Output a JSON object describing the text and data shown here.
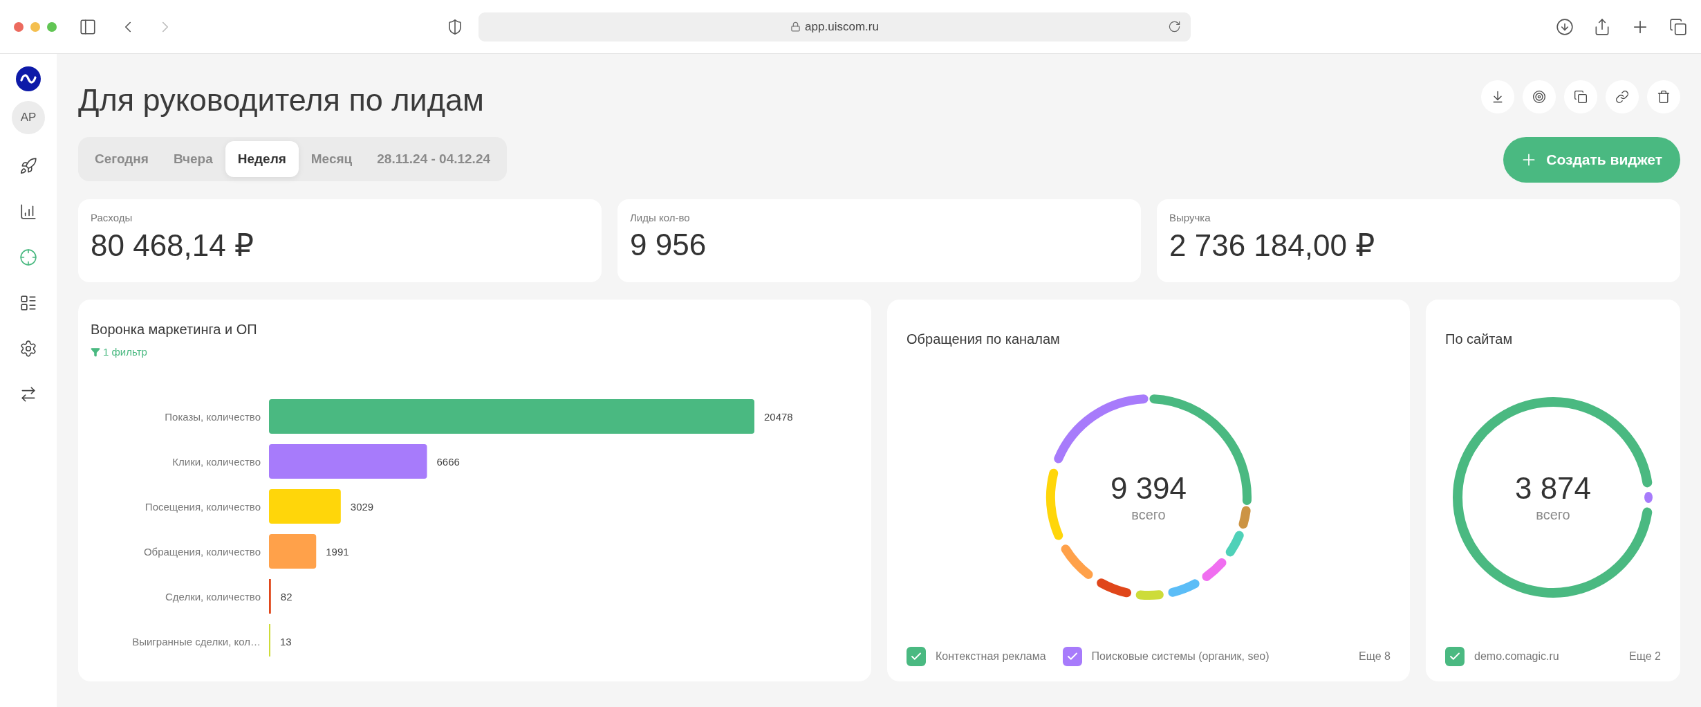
{
  "browser": {
    "url": "app.uiscom.ru"
  },
  "sidebar": {
    "avatar": "AP",
    "items": [
      {
        "kind": "rocket",
        "selected": false
      },
      {
        "kind": "chart",
        "selected": false
      },
      {
        "kind": "target",
        "selected": true
      },
      {
        "kind": "list",
        "selected": false
      },
      {
        "kind": "settings",
        "selected": false
      },
      {
        "kind": "swap",
        "selected": false
      }
    ]
  },
  "page": {
    "title": "Для руководителя по лидам",
    "create_button": "Создать виджет"
  },
  "periods": [
    {
      "label": "Сегодня",
      "selected": false
    },
    {
      "label": "Вчера",
      "selected": false
    },
    {
      "label": "Неделя",
      "selected": true
    },
    {
      "label": "Месяц",
      "selected": false
    },
    {
      "label": "28.11.24 - 04.12.24",
      "selected": false
    }
  ],
  "kpis": [
    {
      "label": "Расходы",
      "value": "80 468,14 ₽"
    },
    {
      "label": "Лиды кол-во",
      "value": "9 956"
    },
    {
      "label": "Выручка",
      "value": "2 736 184,00 ₽"
    }
  ],
  "funnel": {
    "title": "Воронка маркетинга и ОП",
    "filter": "1 фильтр",
    "chart_data": {
      "type": "bar",
      "orientation": "horizontal",
      "data_labels": true,
      "categories": [
        "Показы, количество",
        "Клики, количество",
        "Посещения, количество",
        "Обращения, количество",
        "Сделки, количество",
        "Выигранные сделки, кол…"
      ],
      "values": [
        20478,
        6666,
        3029,
        1991,
        82,
        13
      ]
    }
  },
  "channels": {
    "title": "Обращения по каналам",
    "total": "9 394",
    "total_label": "всего",
    "more": "Еще 8",
    "legend": [
      {
        "label": "Контекстная реклама",
        "checked": true,
        "color": "#4ab981"
      },
      {
        "label": "Поисковые системы (органик, seo)",
        "checked": true,
        "color": "#a77bfb"
      }
    ]
  },
  "sites": {
    "title": "По сайтам",
    "total": "3 874",
    "total_label": "всего",
    "more": "Еще 2",
    "legend": [
      {
        "label": "demo.comagic.ru",
        "checked": true,
        "color": "#4ab981"
      }
    ]
  }
}
